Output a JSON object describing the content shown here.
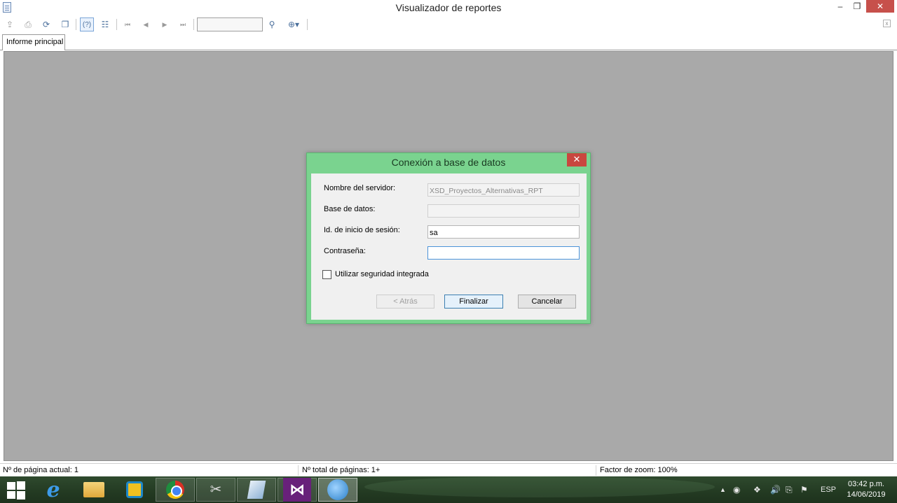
{
  "window": {
    "title": "Visualizador de reportes",
    "minimize_glyph": "‒",
    "maximize_glyph": "❐",
    "close_glyph": "✕"
  },
  "toolbar": {
    "page_input_value": "",
    "icons": [
      "export-icon",
      "print-icon",
      "refresh-icon",
      "copy-icon",
      "help-icon",
      "group-tree-icon",
      "first-page-icon",
      "previous-page-icon",
      "next-page-icon",
      "last-page-icon",
      "find-icon",
      "zoom-icon"
    ],
    "help_glyph": "(?)",
    "close_glyph": "x"
  },
  "tabs": [
    {
      "label": "Informe principal"
    }
  ],
  "statusbar": {
    "current_page": "Nº de página actual: 1",
    "total_pages": "Nº total de páginas: 1+",
    "zoom": "Factor de zoom: 100%"
  },
  "dialog": {
    "title": "Conexión a base de datos",
    "close_glyph": "✕",
    "fields": {
      "server": {
        "label": "Nombre del servidor:",
        "value": "XSD_Proyectos_Alternativas_RPT"
      },
      "database": {
        "label": "Base de datos:",
        "value": ""
      },
      "login": {
        "label": "Id. de inicio de sesión:",
        "value": "sa"
      },
      "password": {
        "label": "Contraseña:",
        "value": ""
      }
    },
    "integrated_security": {
      "label": "Utilizar seguridad integrada",
      "checked": false
    },
    "buttons": {
      "back": "< Atrás",
      "finish": "Finalizar",
      "cancel": "Cancelar"
    },
    "accent_color": "#7ad38f"
  },
  "taskbar": {
    "apps": [
      "windows-start-icon",
      "internet-explorer-icon",
      "file-explorer-icon",
      "yellow-app-icon",
      "chrome-icon",
      "tools-icon",
      "book-icon",
      "visual-studio-icon",
      "web-app-icon"
    ],
    "tray": {
      "language": "ESP",
      "time": "03:42 p.m.",
      "date": "14/06/2019"
    }
  }
}
